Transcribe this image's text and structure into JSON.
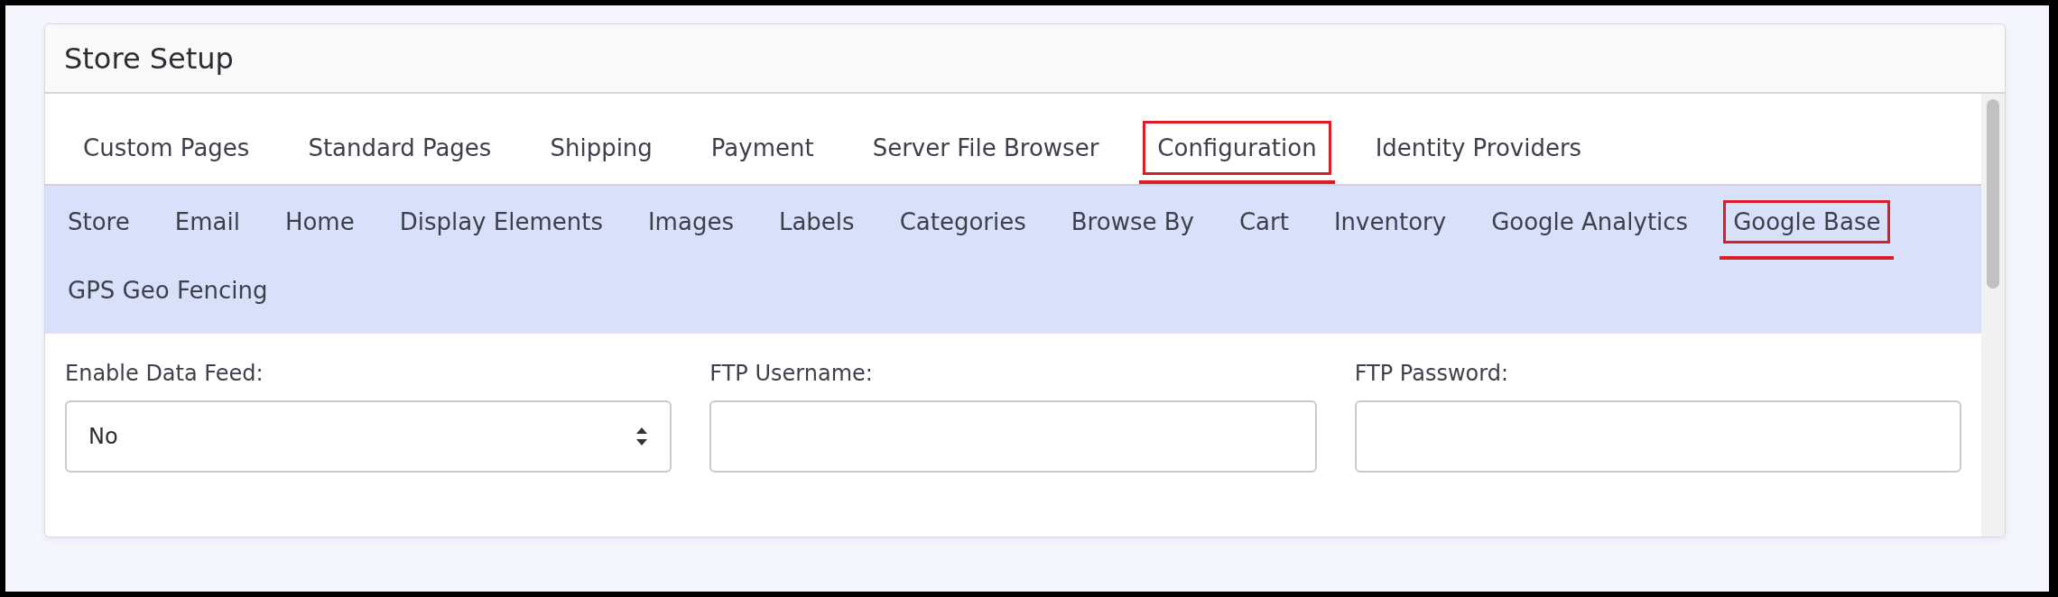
{
  "card": {
    "title": "Store Setup"
  },
  "tabs": [
    {
      "label": "Custom Pages",
      "selected": false
    },
    {
      "label": "Standard Pages",
      "selected": false
    },
    {
      "label": "Shipping",
      "selected": false
    },
    {
      "label": "Payment",
      "selected": false
    },
    {
      "label": "Server File Browser",
      "selected": false
    },
    {
      "label": "Configuration",
      "selected": true
    },
    {
      "label": "Identity Providers",
      "selected": false
    }
  ],
  "subtabs": [
    {
      "label": "Store",
      "selected": false
    },
    {
      "label": "Email",
      "selected": false
    },
    {
      "label": "Home",
      "selected": false
    },
    {
      "label": "Display Elements",
      "selected": false
    },
    {
      "label": "Images",
      "selected": false
    },
    {
      "label": "Labels",
      "selected": false
    },
    {
      "label": "Categories",
      "selected": false
    },
    {
      "label": "Browse By",
      "selected": false
    },
    {
      "label": "Cart",
      "selected": false
    },
    {
      "label": "Inventory",
      "selected": false
    },
    {
      "label": "Google Analytics",
      "selected": false
    },
    {
      "label": "Google Base",
      "selected": true
    },
    {
      "label": "GPS Geo Fencing",
      "selected": false
    }
  ],
  "fields": [
    {
      "kind": "select",
      "label": "Enable Data Feed:",
      "value": "No"
    },
    {
      "kind": "text",
      "label": "FTP Username:"
    },
    {
      "kind": "password",
      "label": "FTP Password:"
    }
  ]
}
